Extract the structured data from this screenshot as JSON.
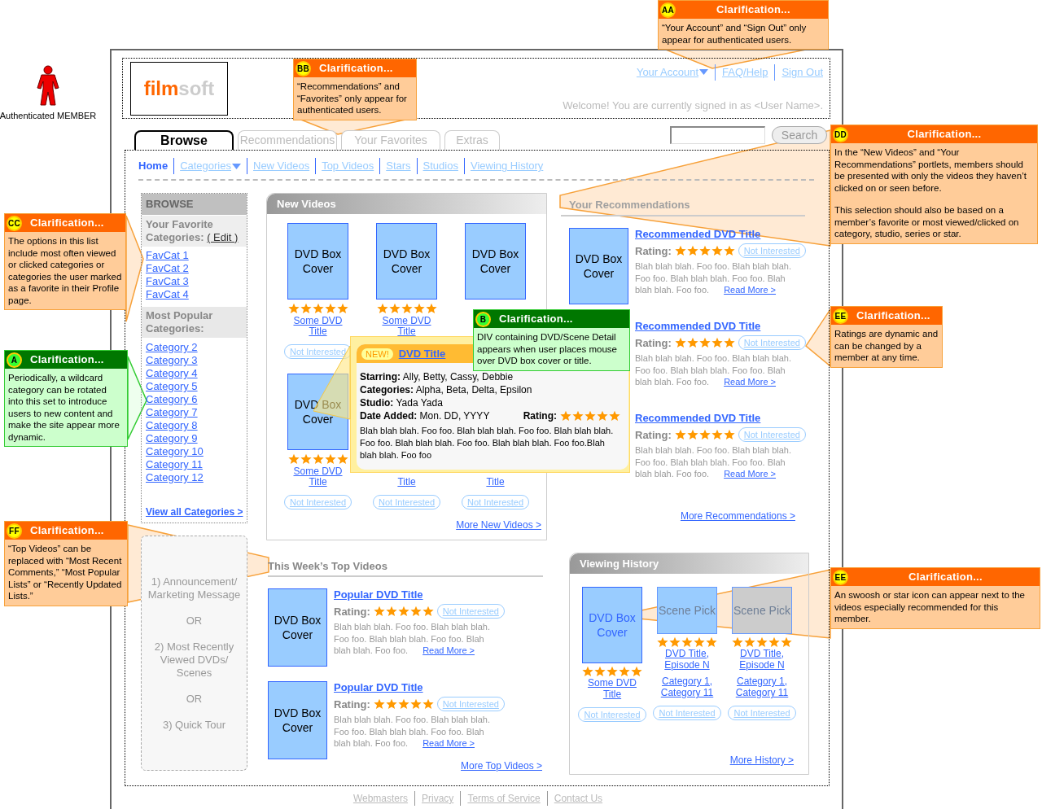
{
  "actor": {
    "label": "Authenticated MEMBER"
  },
  "header": {
    "logo": [
      "film",
      "soft"
    ],
    "links": [
      {
        "label": "Your Account",
        "dropdown": true
      },
      {
        "label": "FAQ/Help",
        "dropdown": false
      },
      {
        "label": "Sign Out",
        "dropdown": false
      }
    ],
    "welcome": "Welcome! You are currently signed in as <User Name>."
  },
  "tabs": [
    {
      "label": "Browse",
      "selected": true
    },
    {
      "label": "Recommendations",
      "selected": false
    },
    {
      "label": "Your Favorites",
      "selected": false
    },
    {
      "label": "Extras",
      "selected": false
    }
  ],
  "search": {
    "button": "Search"
  },
  "nav": [
    {
      "label": "Home",
      "selected": true,
      "dropdown": false
    },
    {
      "label": "Categories",
      "selected": false,
      "dropdown": true
    },
    {
      "label": "New Videos",
      "selected": false,
      "dropdown": false
    },
    {
      "label": "Top Videos",
      "selected": false,
      "dropdown": false
    },
    {
      "label": "Stars",
      "selected": false,
      "dropdown": false
    },
    {
      "label": "Studios",
      "selected": false,
      "dropdown": false
    },
    {
      "label": "Viewing History",
      "selected": false,
      "dropdown": false
    }
  ],
  "sidebar": {
    "title": "BROWSE",
    "favorites_heading": "Your Favorite Categories:",
    "edit_link": "( Edit )",
    "favorites": [
      "FavCat 1",
      "FavCat 2",
      "FavCat 3",
      "FavCat 4"
    ],
    "popular_heading": "Most Popular Categories:",
    "popular": [
      "Category 2",
      "Category 3",
      "Category 4",
      "Category 5",
      "Category 6",
      "Category 7",
      "Category 8",
      "Category 9",
      "Category 10",
      "Category 11",
      "Category 12"
    ],
    "view_all": "View all Categories >"
  },
  "announcement": [
    "1) Announcement/ Marketing Message",
    "OR",
    "2) Most Recently Viewed DVDs/ Scenes",
    "OR",
    "3) Quick Tour"
  ],
  "new_videos": {
    "title": "New Videos",
    "items": [
      {
        "cover": "DVD Box Cover",
        "stars": 5,
        "title": "Some DVD Title",
        "action": "Not Interested"
      },
      {
        "cover": "DVD Box Cover",
        "stars": 5,
        "title": "Some DVD Title"
      },
      {
        "cover": "DVD Box Cover"
      },
      {
        "cover": "DVD Box Cover",
        "stars": 5,
        "title": "Some DVD Title",
        "action": "Not Interested"
      },
      {
        "title": "Title",
        "action": "Not Interested"
      },
      {
        "title": "Title",
        "action": "Not Interested"
      }
    ],
    "more": "More New Videos >"
  },
  "popup": {
    "badge": "NEW!",
    "title": "DVD Title",
    "details": [
      "**Starring:** Ally, Betty, Cassy, Debbie",
      "**Categories:** Alpha, Beta, Delta, Epsilon",
      "**Studio:** Yada Yada"
    ],
    "date_added": "**Date Added:** Mon. DD, YYYY",
    "rating_label": "Rating:",
    "stars": 5,
    "description": "Blah blah blah. Foo foo. Blah blah blah. Foo foo. Blah blah blah. Foo foo. Blah blah blah. Foo foo. Blah blah blah. Foo foo.Blah blah blah. Foo foo"
  },
  "recommendations": {
    "title": "Your Recommendations",
    "items": [
      {
        "cover": "DVD Box Cover",
        "title": "Recommended DVD Title",
        "rating_label": "Rating:",
        "stars": 5,
        "action": "Not Interested",
        "description": "Blah blah blah. Foo foo. Blah blah blah. Foo foo. Blah blah blah. Foo foo. Blah blah blah. Foo foo.",
        "read_more": "Read More >"
      },
      {
        "title": "Recommended DVD Title",
        "rating_label": "Rating:",
        "stars": 5,
        "action": "Not Interested",
        "description": "Blah blah blah. Foo foo. Blah blah blah. Foo foo. Blah blah blah. Foo foo. Blah blah blah. Foo foo.",
        "read_more": "Read More >"
      },
      {
        "title": "Recommended DVD Title",
        "rating_label": "Rating:",
        "stars": 5,
        "action": "Not Interested",
        "description": "Blah blah blah. Foo foo. Blah blah blah. Foo foo. Blah blah blah. Foo foo. Blah blah blah. Foo foo.",
        "read_more": "Read More >"
      }
    ],
    "more": "More Recommendations >"
  },
  "top_videos": {
    "title": "This Week’s Top Videos",
    "items": [
      {
        "cover": "DVD Box Cover",
        "title": "Popular DVD Title",
        "rating_label": "Rating:",
        "stars": 5,
        "action": "Not Interested",
        "description": "Blah blah blah. Foo foo. Blah blah blah. Foo foo. Blah blah blah. Foo foo. Blah blah blah. Foo foo.",
        "read_more": "Read More >"
      },
      {
        "cover": "DVD Box Cover",
        "title": "Popular DVD Title",
        "rating_label": "Rating:",
        "stars": 5,
        "action": "Not Interested",
        "description": "Blah blah blah. Foo foo. Blah blah blah. Foo foo. Blah blah blah. Foo foo. Blah blah blah. Foo foo.",
        "read_more": "Read More >"
      }
    ],
    "more": "More Top Videos >"
  },
  "history": {
    "title": "Viewing History",
    "items": [
      {
        "kind": "dvd",
        "cover": "DVD Box Cover",
        "color": "#99ccff",
        "stars": 5,
        "title": "Some DVD Title",
        "action": "Not Interested"
      },
      {
        "kind": "scene",
        "cover": "Scene Pick",
        "color": "#99ccff",
        "stars": 5,
        "title": "DVD Title, Episode N",
        "categories": "Category 1, Category 11",
        "action": "Not Interested"
      },
      {
        "kind": "scene",
        "cover": "Scene Pick",
        "color": "#cccccc",
        "stars": 5,
        "title": "DVD Title, Episode N",
        "categories": "Category 1, Category 11",
        "action": "Not Interested"
      }
    ],
    "more": "More History >"
  },
  "footer": [
    "Webmasters",
    "Privacy",
    "Terms of Service",
    "Contact Us"
  ],
  "callouts": [
    {
      "badge": "AA",
      "title": "Clarification...",
      "color": "#ff6600",
      "text": [
        "“Your Account” and “Sign Out” only appear for authenticated users."
      ]
    },
    {
      "badge": "BB",
      "title": "Clarification...",
      "color": "#ff6600",
      "text": [
        "“Recommendations” and “Favorites” only appear for authenticated users."
      ]
    },
    {
      "badge": "CC",
      "title": "Clarification...",
      "color": "#ff6600",
      "text": [
        "The options in this list include most often viewed or clicked categories or categories the user marked as a favorite in their Profile page."
      ]
    },
    {
      "badge": "A",
      "title": "Clarification...",
      "color": "#007700",
      "text": [
        "Periodically, a wildcard category can be rotated into this set to introduce users to new content and make the site appear more dynamic."
      ]
    },
    {
      "badge": "DD",
      "title": "Clarification...",
      "color": "#ff6600",
      "text": [
        "In the “New Videos” and “Your Recommendations” portlets, members should be presented with only the videos they haven’t clicked on or seen before.",
        "This selection should also be based on a member’s favorite or most viewed/clicked on category, studio, series or star."
      ]
    },
    {
      "badge": "B",
      "title": "Clarification...",
      "color": "#007700",
      "text": [
        "DIV containing DVD/Scene Detail appears when user places mouse over DVD box cover or title."
      ]
    },
    {
      "badge": "EE",
      "title": "Clarification...",
      "color": "#ff6600",
      "text": [
        "Ratings are dynamic and can be changed by a member at any time."
      ]
    },
    {
      "badge": "FF",
      "title": "Clarification...",
      "color": "#ff6600",
      "text": [
        "“Top Videos” can be replaced with “Most Recent Comments,” “Most Popular Lists” or “Recently Updated Lists.”"
      ]
    },
    {
      "badge": "EE",
      "title": "Clarification...",
      "color": "#ff6600",
      "text": [
        "An swoosh or star icon can appear next to the videos especially recommended for this member."
      ]
    }
  ]
}
